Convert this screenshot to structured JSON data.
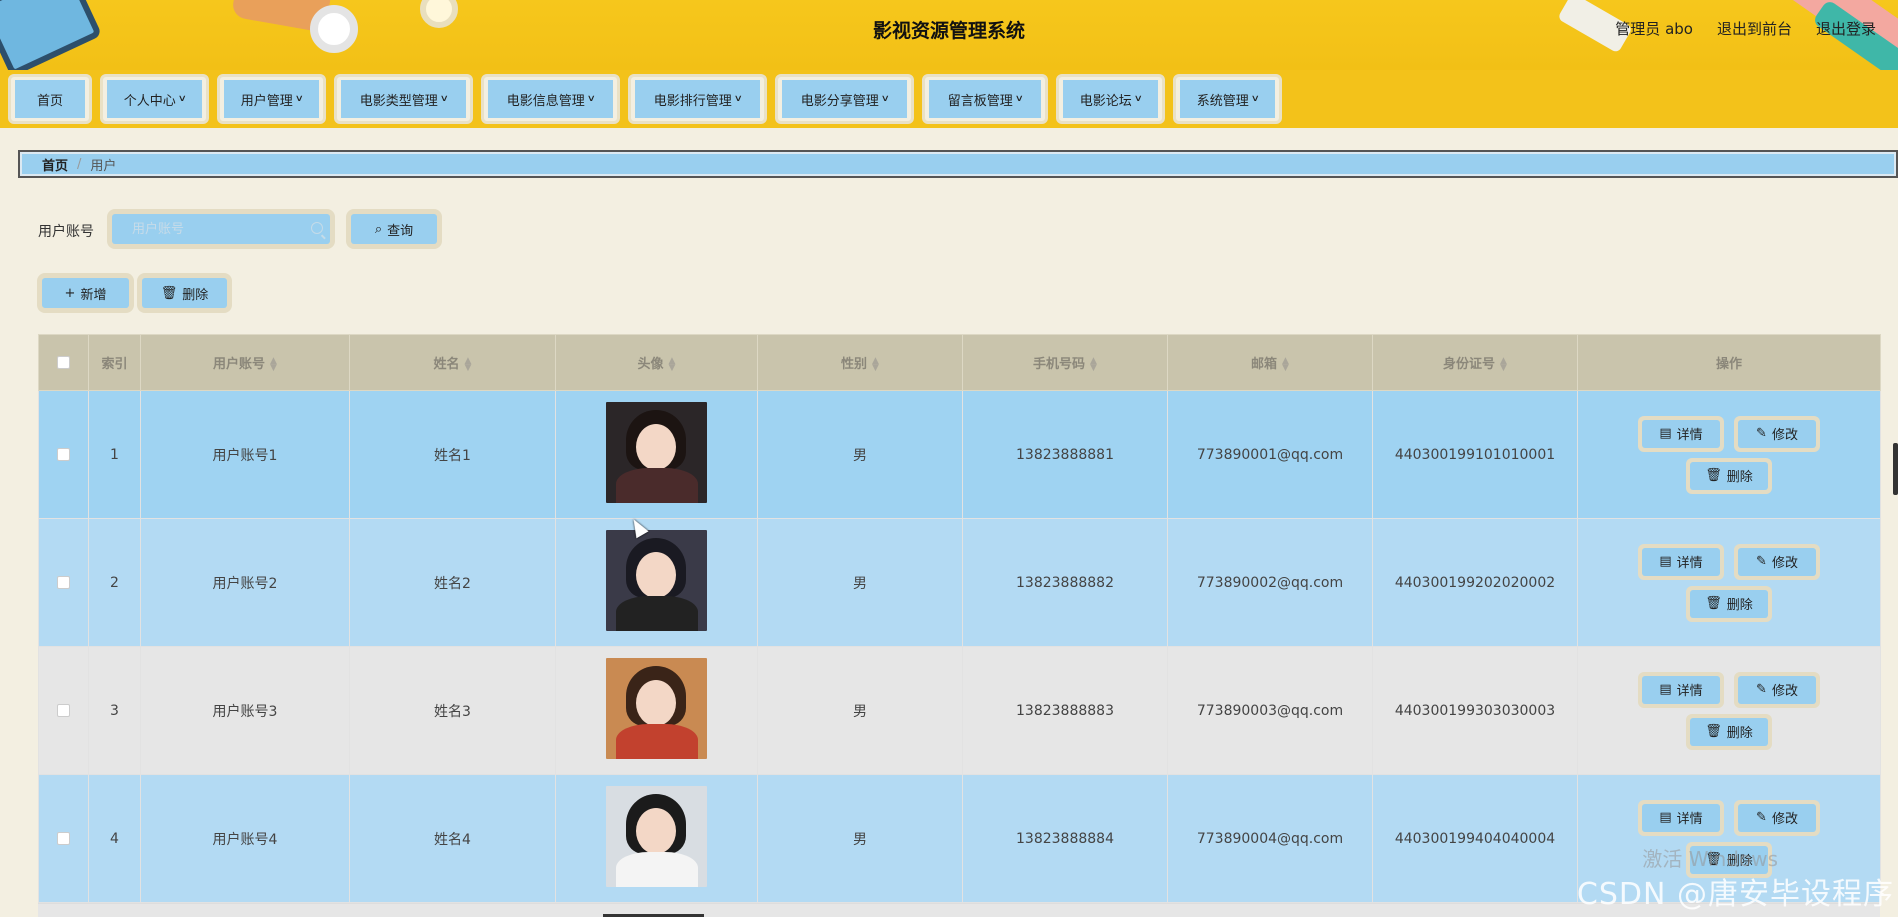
{
  "header": {
    "title": "影视资源管理系统",
    "admin": "管理员 abo",
    "back_front": "退出到前台",
    "logout": "退出登录"
  },
  "menu": [
    {
      "label": "首页",
      "has_dropdown": false
    },
    {
      "label": "个人中心",
      "has_dropdown": true
    },
    {
      "label": "用户管理",
      "has_dropdown": true
    },
    {
      "label": "电影类型管理",
      "has_dropdown": true
    },
    {
      "label": "电影信息管理",
      "has_dropdown": true
    },
    {
      "label": "电影排行管理",
      "has_dropdown": true
    },
    {
      "label": "电影分享管理",
      "has_dropdown": true
    },
    {
      "label": "留言板管理",
      "has_dropdown": true
    },
    {
      "label": "电影论坛",
      "has_dropdown": true
    },
    {
      "label": "系统管理",
      "has_dropdown": true
    }
  ],
  "breadcrumb": {
    "home": "首页",
    "separator": "/",
    "current": "用户"
  },
  "search": {
    "label": "用户账号",
    "placeholder": "用户账号",
    "value": "",
    "button": "查询"
  },
  "actions": {
    "add": "新增",
    "delete": "删除"
  },
  "table": {
    "columns": [
      "索引",
      "用户账号",
      "姓名",
      "头像",
      "性别",
      "手机号码",
      "邮箱",
      "身份证号",
      "操作"
    ],
    "rows": [
      {
        "index": "1",
        "account": "用户账号1",
        "name": "姓名1",
        "gender": "男",
        "phone": "13823888881",
        "email": "773890001@qq.com",
        "id_card": "440300199101010001"
      },
      {
        "index": "2",
        "account": "用户账号2",
        "name": "姓名2",
        "gender": "男",
        "phone": "13823888882",
        "email": "773890002@qq.com",
        "id_card": "440300199202020002"
      },
      {
        "index": "3",
        "account": "用户账号3",
        "name": "姓名3",
        "gender": "男",
        "phone": "13823888883",
        "email": "773890003@qq.com",
        "id_card": "440300199303030003"
      },
      {
        "index": "4",
        "account": "用户账号4",
        "name": "姓名4",
        "gender": "男",
        "phone": "13823888884",
        "email": "773890004@qq.com",
        "id_card": "440300199404040004"
      }
    ],
    "row_actions": {
      "detail": "详情",
      "edit": "修改",
      "delete": "删除"
    }
  },
  "watermark": {
    "csdn": "CSDN @唐安毕设程序",
    "activate": "激活 Windows"
  },
  "colors": {
    "header_yellow": "#f2c016",
    "button_blue": "#99cfef",
    "page_bg": "#f3efe1",
    "button_frame": "#e4dcc3"
  }
}
